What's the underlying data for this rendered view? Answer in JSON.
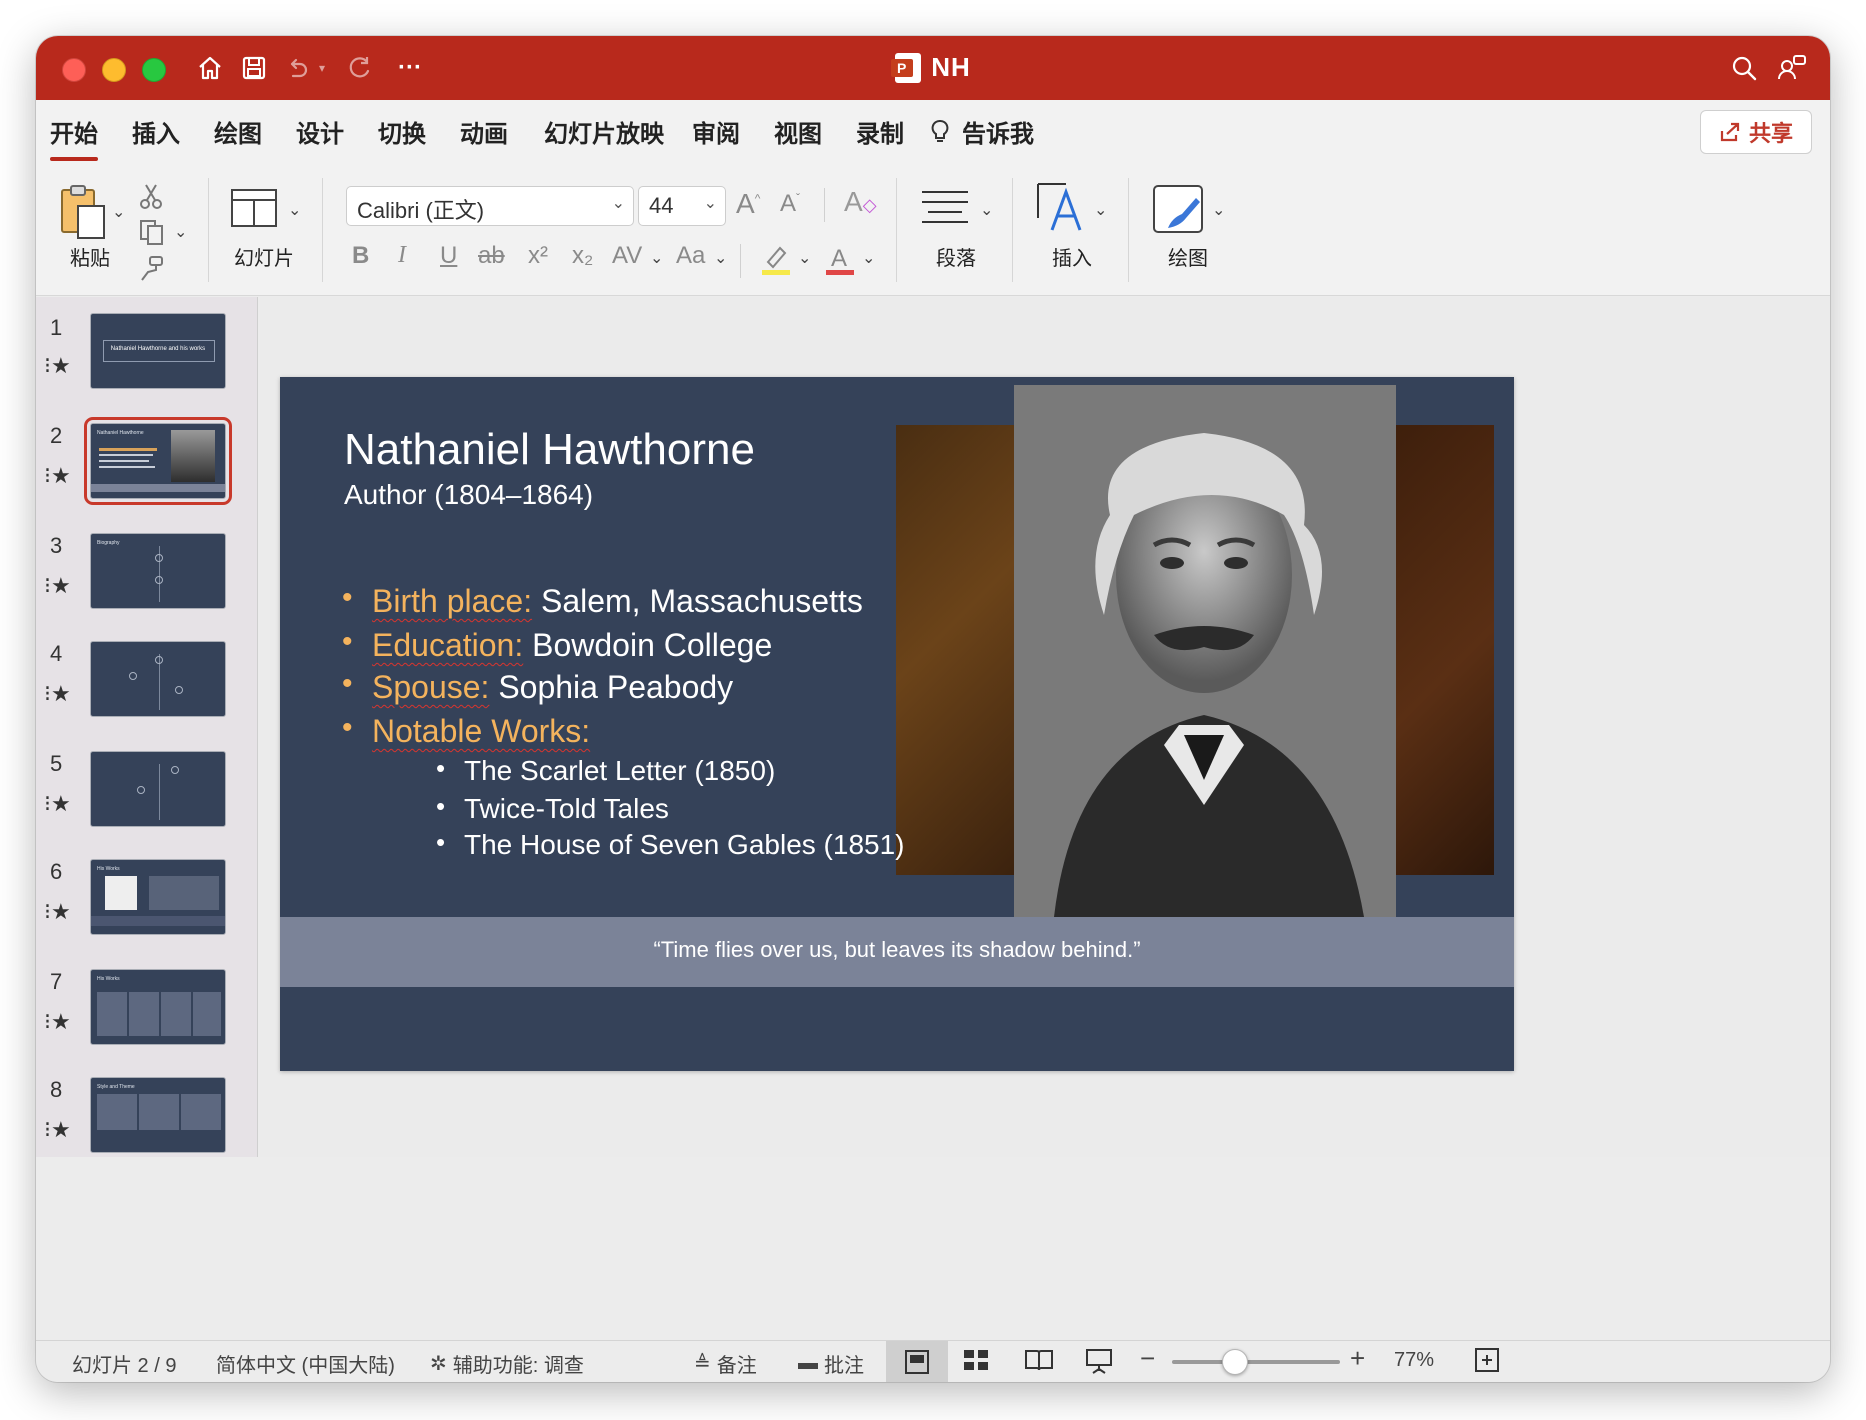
{
  "window": {
    "title": "NH",
    "app_badge": "P"
  },
  "tabs": [
    {
      "label": "开始",
      "active": true
    },
    {
      "label": "插入"
    },
    {
      "label": "绘图"
    },
    {
      "label": "设计"
    },
    {
      "label": "切换"
    },
    {
      "label": "动画"
    },
    {
      "label": "幻灯片放映"
    },
    {
      "label": "审阅"
    },
    {
      "label": "视图"
    },
    {
      "label": "录制"
    },
    {
      "label": "告诉我"
    }
  ],
  "share_label": "共享",
  "ribbon": {
    "paste_label": "粘贴",
    "slide_label": "幻灯片",
    "font_name": "Calibri (正文)",
    "font_size": "44",
    "paragraph_label": "段落",
    "insert_label": "插入",
    "draw_label": "绘图",
    "format_buttons": [
      "B",
      "I",
      "U",
      "ab",
      "x²",
      "x₂",
      "AV",
      "Aa"
    ]
  },
  "thumbnails": [
    {
      "number": "1",
      "caption": "Nathaniel Hawthorne and his works",
      "type": "title"
    },
    {
      "number": "2",
      "caption": "Nathaniel Hawthorne",
      "type": "bio",
      "selected": true
    },
    {
      "number": "3",
      "caption": "Biography",
      "type": "timeline"
    },
    {
      "number": "4",
      "caption": "",
      "type": "timeline"
    },
    {
      "number": "5",
      "caption": "",
      "type": "timeline"
    },
    {
      "number": "6",
      "caption": "His Works",
      "type": "works"
    },
    {
      "number": "7",
      "caption": "His Works",
      "type": "table"
    },
    {
      "number": "8",
      "caption": "Style and Theme",
      "type": "table"
    }
  ],
  "slide": {
    "title": "Nathaniel Hawthorne",
    "subtitle": "Author (1804–1864)",
    "bullets": [
      {
        "key": "Birth place:",
        "value": " Salem, Massachusetts"
      },
      {
        "key": "Education:",
        "value": " Bowdoin College"
      },
      {
        "key": "Spouse:",
        "value": " Sophia Peabody"
      },
      {
        "key": "Notable Works:",
        "value": ""
      }
    ],
    "works": [
      "The Scarlet Letter (1850)",
      "Twice-Told Tales",
      "The House of Seven Gables (1851)"
    ],
    "quote": "“Time flies over us, but leaves its shadow behind.”"
  },
  "status": {
    "slide_info": "幻灯片 2 / 9",
    "language": "简体中文 (中国大陆)",
    "accessibility": "辅助功能: 调查",
    "notes": "备注",
    "comments": "批注",
    "zoom": "77%",
    "zoom_level_fraction": 0.42
  },
  "colors": {
    "titlebar": "#b8291c",
    "slide_bg": "#354259",
    "accent": "#f4b35d",
    "quote_band": "#7b8398"
  }
}
